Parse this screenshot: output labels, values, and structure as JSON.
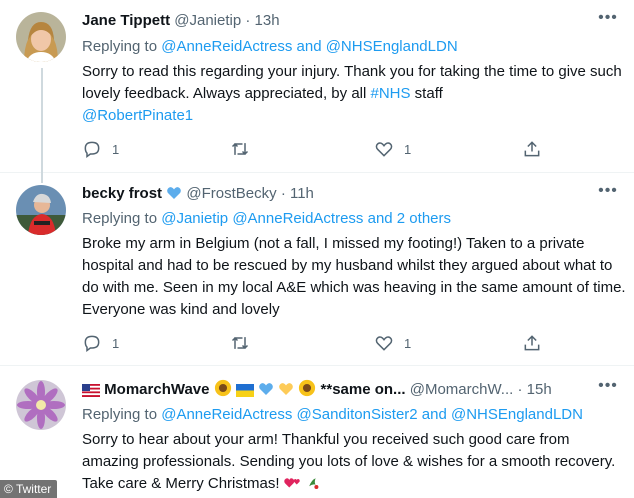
{
  "tweets": [
    {
      "name": "Jane Tippett",
      "handle": "@Janietip",
      "dot": "·",
      "time": "13h",
      "replying_prefix": "Replying to",
      "replying_mentions": "@AnneReidActress and @NHSEnglandLDN",
      "body_part1": "Sorry to read this regarding your injury. Thank you for taking the time to give such lovely feedback. Always appreciated, by all ",
      "body_hashtag": "#NHS",
      "body_part2": " staff",
      "body_mention": "@RobertPinate1",
      "replies": "1",
      "likes": "1"
    },
    {
      "name": "becky frost",
      "handle": "@FrostBecky",
      "dot": "·",
      "time": "11h",
      "replying_prefix": "Replying to",
      "replying_mentions": "@Janietip @AnneReidActress and 2 others",
      "body": "Broke my arm in Belgium (not a fall, I missed my footing!) Taken to a private hospital and had to be rescued by my husband whilst they argued about what to do with me. Seen in my local A&E which was heaving in the same amount of time. Everyone was kind and lovely",
      "replies": "1",
      "likes": "1"
    },
    {
      "name": "MomarchWave",
      "name_suffix": "**same on...",
      "handle": "@MomarchW...",
      "dot": "·",
      "time": "15h",
      "replying_prefix": "Replying to",
      "replying_mentions": "@AnneReidActress @SanditonSister2 and @NHSEnglandLDN",
      "body": "Sorry to hear about your arm! Thankful you received such good care from amazing professionals. Sending you lots of love & wishes for a smooth recovery. Take care & Merry Christmas!"
    }
  ],
  "watermark": "© Twitter",
  "colors": {
    "accent": "#1d9bf0",
    "secondary_text": "#536471",
    "primary_text": "#0f1419",
    "divider": "#eff3f4",
    "thread_line": "#cfd9de"
  },
  "icons": [
    "reply-icon",
    "retweet-icon",
    "like-icon",
    "share-icon",
    "more-icon",
    "blue-heart-emoji",
    "us-flag-emoji",
    "sunflower-emoji",
    "ukraine-flag-emoji",
    "yellow-heart-emoji",
    "hearts-emoji",
    "holly-emoji"
  ]
}
